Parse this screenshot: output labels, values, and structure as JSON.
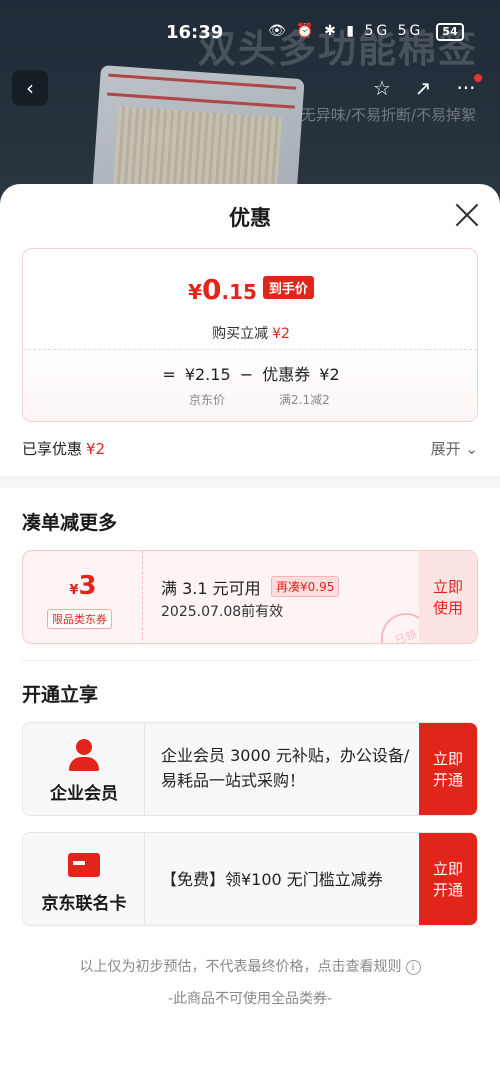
{
  "status_bar": {
    "time": "16:39",
    "icons": "👁 ⏰ ✱ ▮ 5G 5G",
    "battery": "54"
  },
  "product_bg": {
    "title": "双头多功能棉签",
    "subtitle": "无异味/不易折断/不易掉絮"
  },
  "nav": {
    "back": "‹",
    "star": "☆",
    "share": "↗",
    "more": "···"
  },
  "sheet": {
    "title": "优惠"
  },
  "price": {
    "currency": "¥",
    "final_int": "0",
    "final_dec": ".15",
    "tag": "到手价",
    "saved_label": "购买立减",
    "saved_value": "¥2",
    "formula": "=  ¥2.15  −  优惠券 ¥2",
    "jd_price_label": "京东价",
    "coupon_rule": "满2.1减2"
  },
  "enjoyed": {
    "label": "已享优惠",
    "value": "¥2",
    "expand": "展开 ⌄"
  },
  "section_more": {
    "title": "凑单减更多"
  },
  "coupon": {
    "currency": "¥",
    "amount": "3",
    "kind": "限品类东券",
    "condition": "满 3.1 元可用",
    "extra": "再凑¥0.95",
    "date": "2025.07.08前有效",
    "button": "立即\n使用",
    "stamp": "已领"
  },
  "section_open": {
    "title": "开通立享"
  },
  "cards": [
    {
      "label": "企业会员",
      "text": "企业会员 3000 元补贴，办公设备/易耗品一站式采购！",
      "button_1": "立即",
      "button_2": "开通"
    },
    {
      "label": "京东联名卡",
      "text": "【免费】领¥100 无门槛立减券",
      "button_1": "立即",
      "button_2": "开通"
    }
  ],
  "footer": {
    "note": "以上仅为初步预估，不代表最终价格，点击查看规则",
    "info_icon": "i",
    "note2": "-此商品不可使用全品类券-"
  },
  "colors": {
    "accent": "#e1251b",
    "light_accent": "#fff4f4"
  }
}
